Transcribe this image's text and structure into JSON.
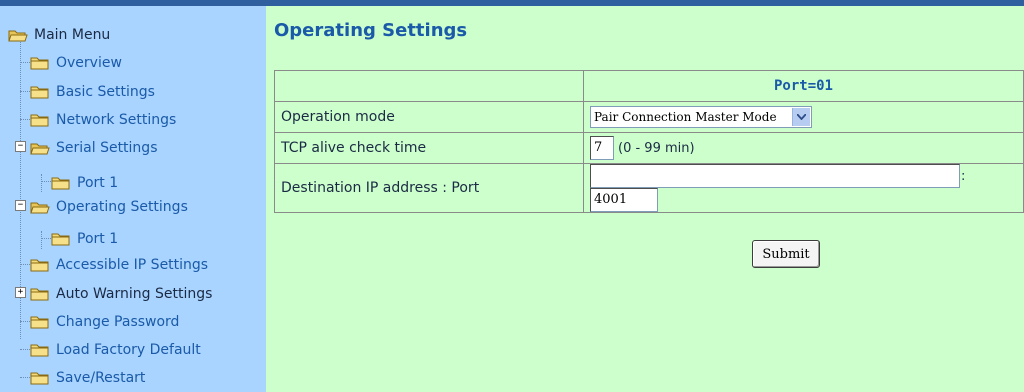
{
  "sidebar": {
    "main_menu": "Main Menu",
    "items": [
      {
        "label": "Overview"
      },
      {
        "label": "Basic Settings"
      },
      {
        "label": "Network Settings"
      },
      {
        "label": "Serial Settings"
      },
      {
        "label": "Port 1"
      },
      {
        "label": "Operating Settings"
      },
      {
        "label": "Port 1"
      },
      {
        "label": "Accessible IP Settings"
      },
      {
        "label": "Auto Warning Settings"
      },
      {
        "label": "Change Password"
      },
      {
        "label": "Load Factory Default"
      },
      {
        "label": "Save/Restart"
      }
    ],
    "expand_minus": "−",
    "expand_plus": "+"
  },
  "main": {
    "title": "Operating Settings",
    "port_header": "Port=01",
    "rows": {
      "operation_mode": {
        "label": "Operation mode",
        "value": "Pair Connection Master Mode"
      },
      "tcp_alive": {
        "label": "TCP alive check time",
        "value": "7",
        "hint": "(0 - 99 min)"
      },
      "dest_ip": {
        "label": "Destination IP address : Port",
        "ip_value": "",
        "separator": ":",
        "port_value": "4001"
      }
    },
    "submit_label": "Submit"
  },
  "colors": {
    "sidebar_bg": "#a9d4ff",
    "main_bg": "#ccffcc",
    "link": "#1a5aa8",
    "title": "#1a5aa8"
  }
}
